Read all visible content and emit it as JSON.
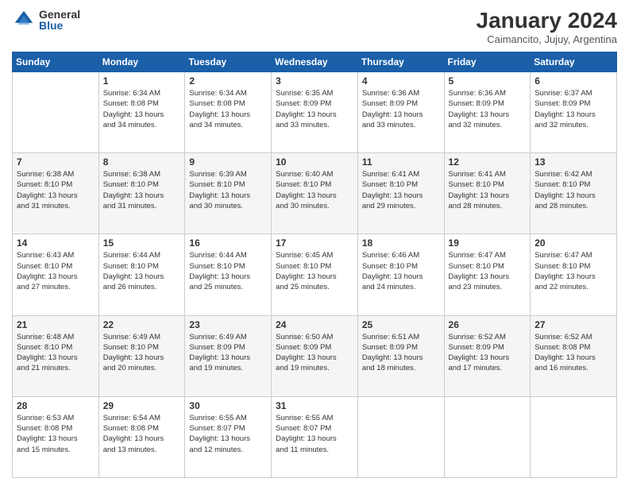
{
  "logo": {
    "general": "General",
    "blue": "Blue"
  },
  "title": "January 2024",
  "subtitle": "Caimancito, Jujuy, Argentina",
  "days_of_week": [
    "Sunday",
    "Monday",
    "Tuesday",
    "Wednesday",
    "Thursday",
    "Friday",
    "Saturday"
  ],
  "weeks": [
    [
      {
        "day": "",
        "info": ""
      },
      {
        "day": "1",
        "info": "Sunrise: 6:34 AM\nSunset: 8:08 PM\nDaylight: 13 hours\nand 34 minutes."
      },
      {
        "day": "2",
        "info": "Sunrise: 6:34 AM\nSunset: 8:08 PM\nDaylight: 13 hours\nand 34 minutes."
      },
      {
        "day": "3",
        "info": "Sunrise: 6:35 AM\nSunset: 8:09 PM\nDaylight: 13 hours\nand 33 minutes."
      },
      {
        "day": "4",
        "info": "Sunrise: 6:36 AM\nSunset: 8:09 PM\nDaylight: 13 hours\nand 33 minutes."
      },
      {
        "day": "5",
        "info": "Sunrise: 6:36 AM\nSunset: 8:09 PM\nDaylight: 13 hours\nand 32 minutes."
      },
      {
        "day": "6",
        "info": "Sunrise: 6:37 AM\nSunset: 8:09 PM\nDaylight: 13 hours\nand 32 minutes."
      }
    ],
    [
      {
        "day": "7",
        "info": "Sunrise: 6:38 AM\nSunset: 8:10 PM\nDaylight: 13 hours\nand 31 minutes."
      },
      {
        "day": "8",
        "info": "Sunrise: 6:38 AM\nSunset: 8:10 PM\nDaylight: 13 hours\nand 31 minutes."
      },
      {
        "day": "9",
        "info": "Sunrise: 6:39 AM\nSunset: 8:10 PM\nDaylight: 13 hours\nand 30 minutes."
      },
      {
        "day": "10",
        "info": "Sunrise: 6:40 AM\nSunset: 8:10 PM\nDaylight: 13 hours\nand 30 minutes."
      },
      {
        "day": "11",
        "info": "Sunrise: 6:41 AM\nSunset: 8:10 PM\nDaylight: 13 hours\nand 29 minutes."
      },
      {
        "day": "12",
        "info": "Sunrise: 6:41 AM\nSunset: 8:10 PM\nDaylight: 13 hours\nand 28 minutes."
      },
      {
        "day": "13",
        "info": "Sunrise: 6:42 AM\nSunset: 8:10 PM\nDaylight: 13 hours\nand 28 minutes."
      }
    ],
    [
      {
        "day": "14",
        "info": "Sunrise: 6:43 AM\nSunset: 8:10 PM\nDaylight: 13 hours\nand 27 minutes."
      },
      {
        "day": "15",
        "info": "Sunrise: 6:44 AM\nSunset: 8:10 PM\nDaylight: 13 hours\nand 26 minutes."
      },
      {
        "day": "16",
        "info": "Sunrise: 6:44 AM\nSunset: 8:10 PM\nDaylight: 13 hours\nand 25 minutes."
      },
      {
        "day": "17",
        "info": "Sunrise: 6:45 AM\nSunset: 8:10 PM\nDaylight: 13 hours\nand 25 minutes."
      },
      {
        "day": "18",
        "info": "Sunrise: 6:46 AM\nSunset: 8:10 PM\nDaylight: 13 hours\nand 24 minutes."
      },
      {
        "day": "19",
        "info": "Sunrise: 6:47 AM\nSunset: 8:10 PM\nDaylight: 13 hours\nand 23 minutes."
      },
      {
        "day": "20",
        "info": "Sunrise: 6:47 AM\nSunset: 8:10 PM\nDaylight: 13 hours\nand 22 minutes."
      }
    ],
    [
      {
        "day": "21",
        "info": "Sunrise: 6:48 AM\nSunset: 8:10 PM\nDaylight: 13 hours\nand 21 minutes."
      },
      {
        "day": "22",
        "info": "Sunrise: 6:49 AM\nSunset: 8:10 PM\nDaylight: 13 hours\nand 20 minutes."
      },
      {
        "day": "23",
        "info": "Sunrise: 6:49 AM\nSunset: 8:09 PM\nDaylight: 13 hours\nand 19 minutes."
      },
      {
        "day": "24",
        "info": "Sunrise: 6:50 AM\nSunset: 8:09 PM\nDaylight: 13 hours\nand 19 minutes."
      },
      {
        "day": "25",
        "info": "Sunrise: 6:51 AM\nSunset: 8:09 PM\nDaylight: 13 hours\nand 18 minutes."
      },
      {
        "day": "26",
        "info": "Sunrise: 6:52 AM\nSunset: 8:09 PM\nDaylight: 13 hours\nand 17 minutes."
      },
      {
        "day": "27",
        "info": "Sunrise: 6:52 AM\nSunset: 8:08 PM\nDaylight: 13 hours\nand 16 minutes."
      }
    ],
    [
      {
        "day": "28",
        "info": "Sunrise: 6:53 AM\nSunset: 8:08 PM\nDaylight: 13 hours\nand 15 minutes."
      },
      {
        "day": "29",
        "info": "Sunrise: 6:54 AM\nSunset: 8:08 PM\nDaylight: 13 hours\nand 13 minutes."
      },
      {
        "day": "30",
        "info": "Sunrise: 6:55 AM\nSunset: 8:07 PM\nDaylight: 13 hours\nand 12 minutes."
      },
      {
        "day": "31",
        "info": "Sunrise: 6:55 AM\nSunset: 8:07 PM\nDaylight: 13 hours\nand 11 minutes."
      },
      {
        "day": "",
        "info": ""
      },
      {
        "day": "",
        "info": ""
      },
      {
        "day": "",
        "info": ""
      }
    ]
  ]
}
